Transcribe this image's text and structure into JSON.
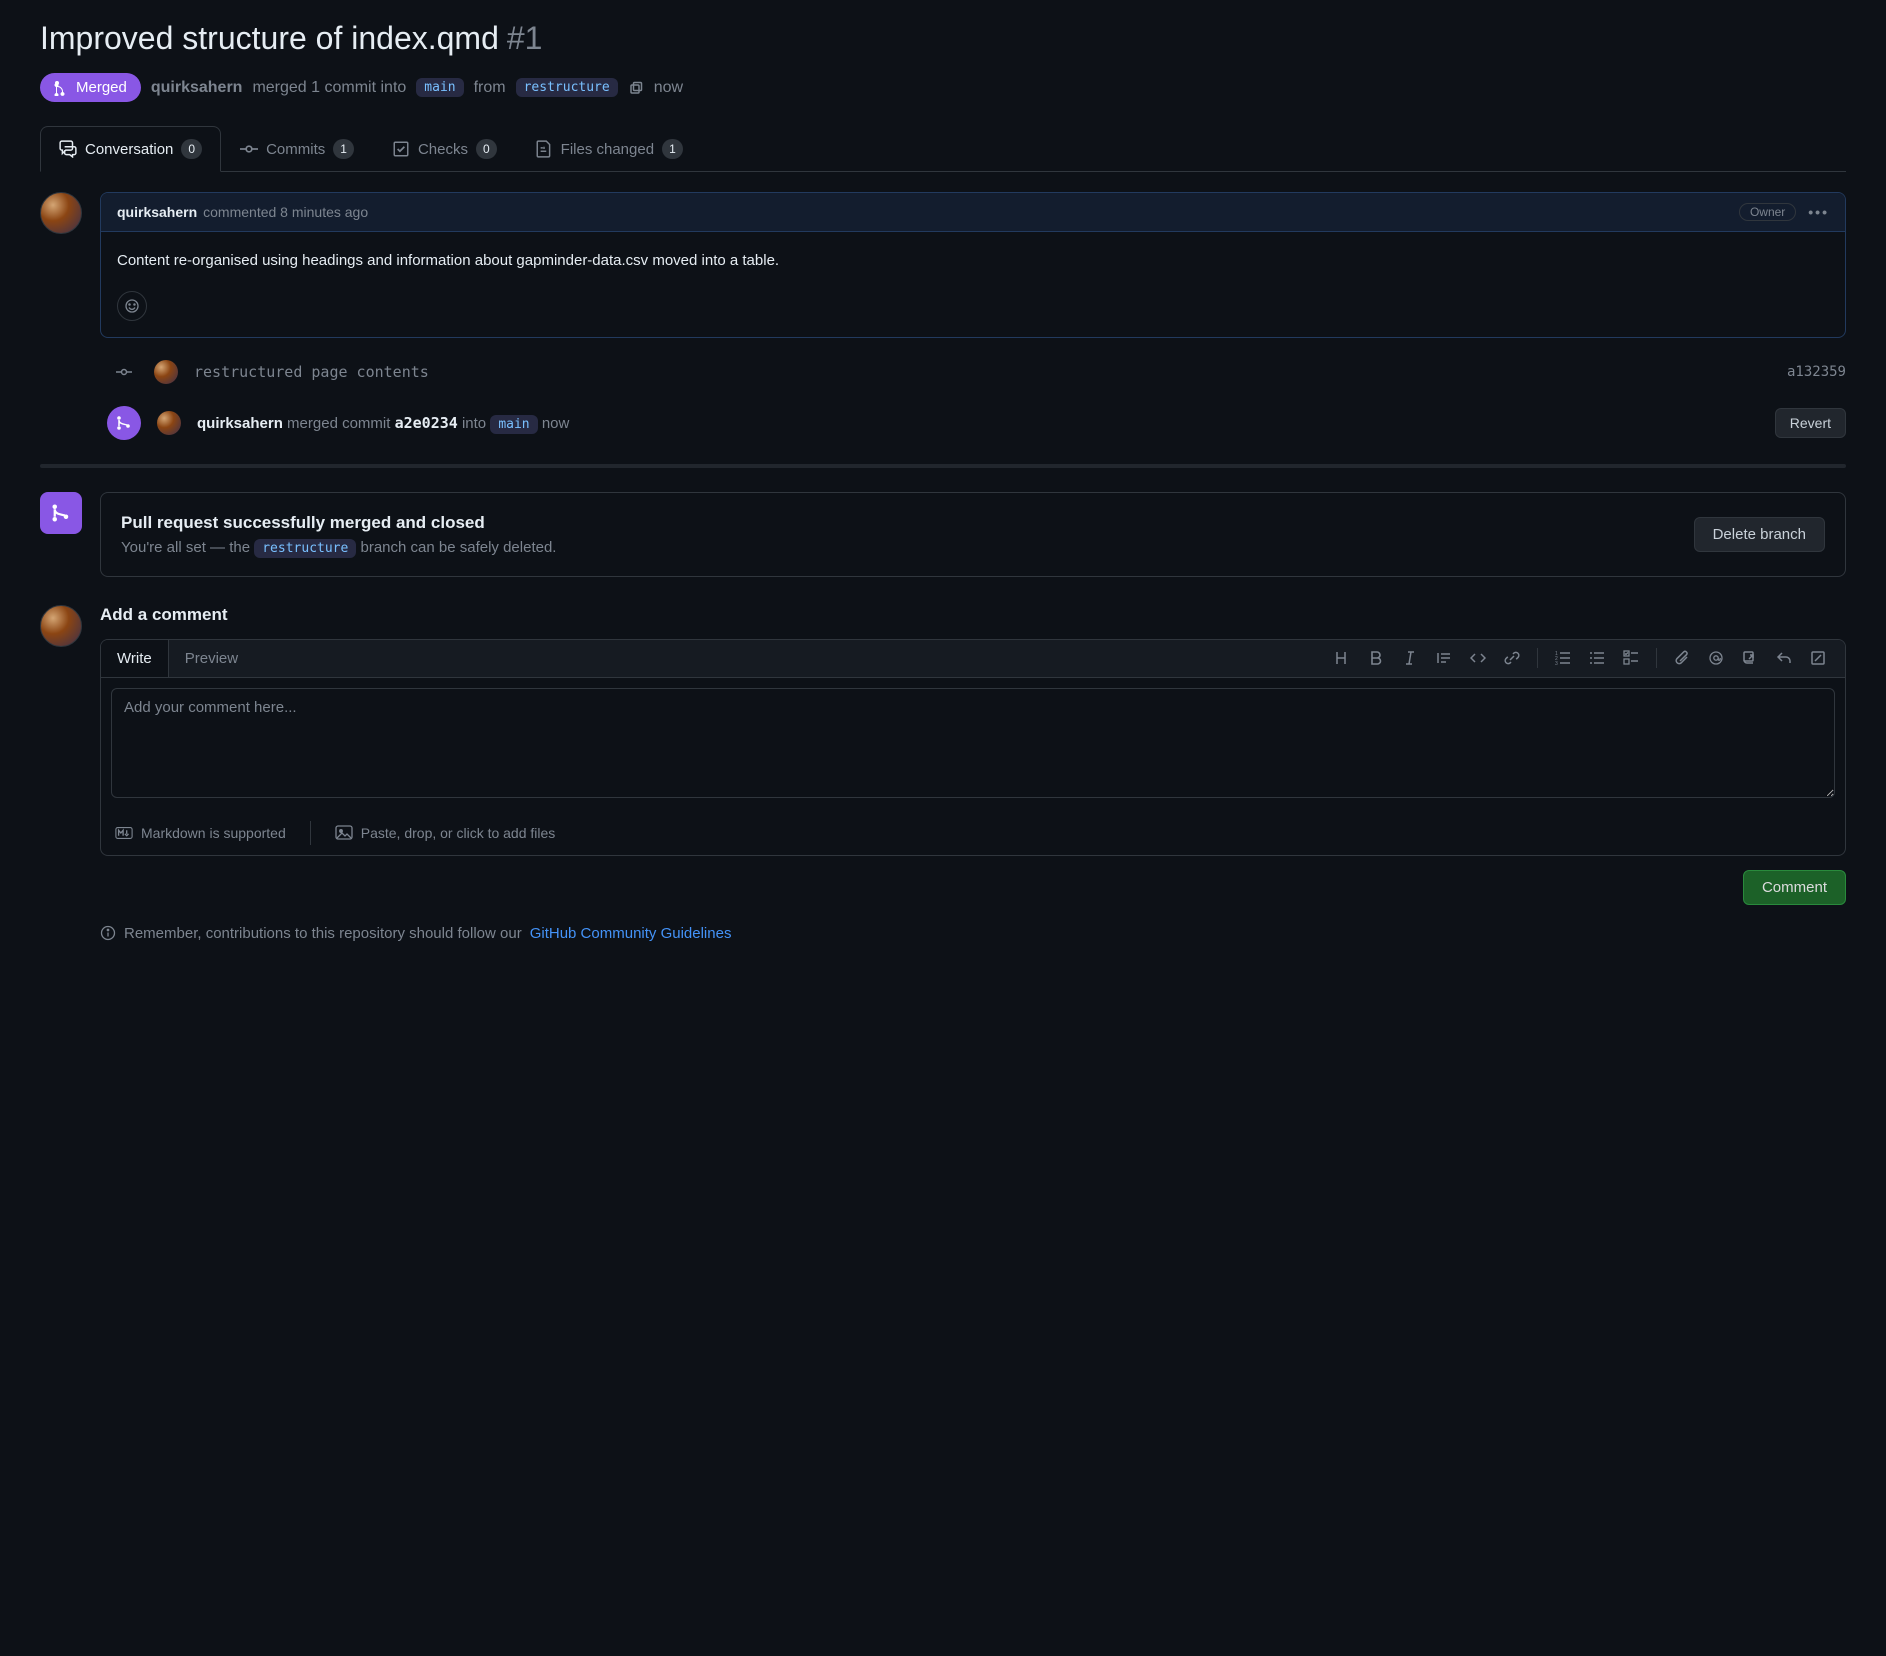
{
  "title": "Improved structure of index.qmd",
  "prNumber": "#1",
  "status": {
    "label": "Merged",
    "author": "quirksahern",
    "action": "merged 1 commit into",
    "targetBranch": "main",
    "from": "from",
    "sourceBranch": "restructure",
    "time": "now"
  },
  "tabs": {
    "conversation": {
      "label": "Conversation",
      "count": "0"
    },
    "commits": {
      "label": "Commits",
      "count": "1"
    },
    "checks": {
      "label": "Checks",
      "count": "0"
    },
    "filesChanged": {
      "label": "Files changed",
      "count": "1"
    }
  },
  "comment": {
    "author": "quirksahern",
    "meta": "commented 8 minutes ago",
    "ownerBadge": "Owner",
    "body": "Content re-organised using headings and information about gapminder-data.csv moved into a table."
  },
  "commitEvent": {
    "message": "restructured page contents",
    "hash": "a132359"
  },
  "mergeEvent": {
    "user": "quirksahern",
    "action": "merged commit",
    "hash": "a2e0234",
    "into": "into",
    "branch": "main",
    "time": "now",
    "revertLabel": "Revert"
  },
  "mergePanel": {
    "title": "Pull request successfully merged and closed",
    "subtextPrefix": "You're all set — the",
    "branch": "restructure",
    "subtextSuffix": "branch can be safely deleted.",
    "deleteLabel": "Delete branch"
  },
  "addComment": {
    "heading": "Add a comment",
    "writeTab": "Write",
    "previewTab": "Preview",
    "placeholder": "Add your comment here...",
    "markdownNote": "Markdown is supported",
    "filesNote": "Paste, drop, or click to add files",
    "submitLabel": "Comment"
  },
  "guideline": {
    "prefix": "Remember, contributions to this repository should follow our",
    "link": "GitHub Community Guidelines"
  }
}
